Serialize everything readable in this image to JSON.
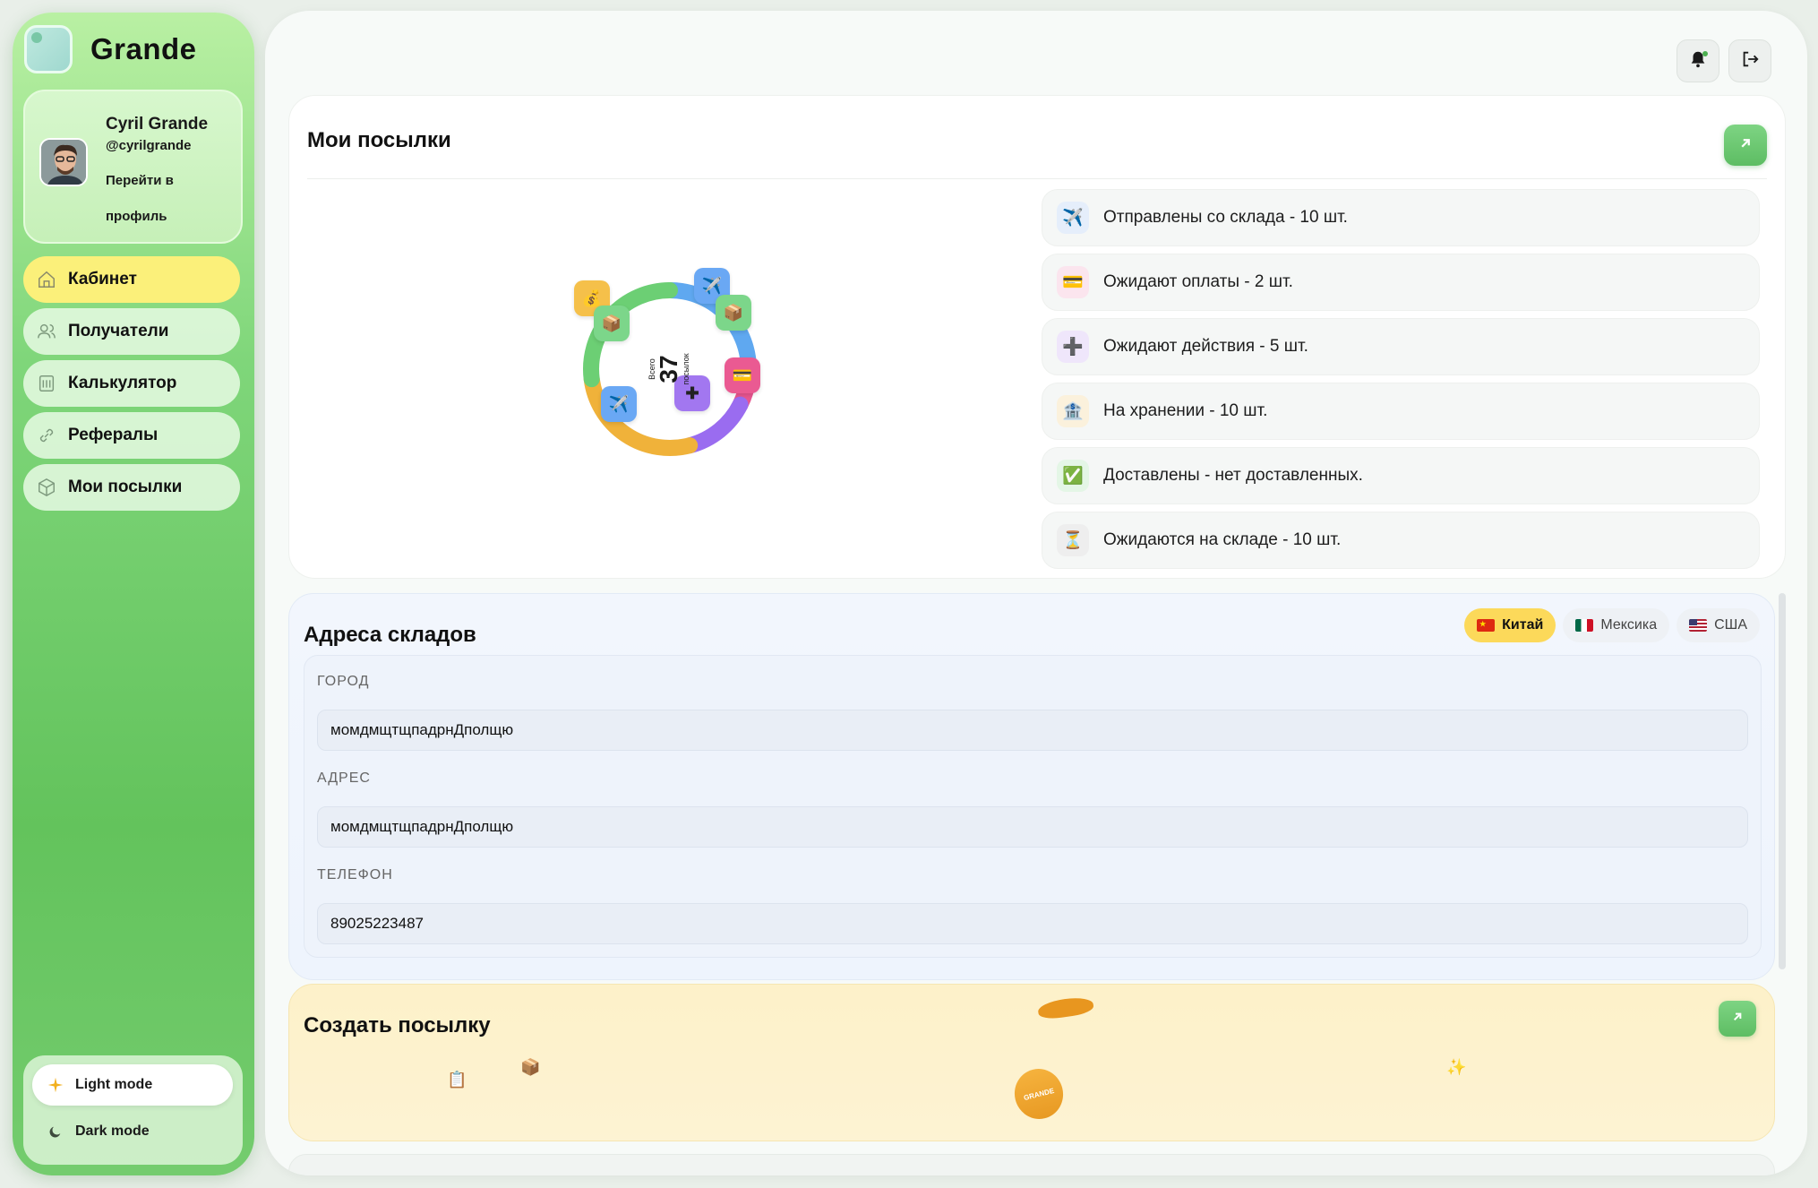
{
  "app": {
    "name": "Grande"
  },
  "profile": {
    "name": "Cyril Grande",
    "handle": "@cyrilgrande",
    "link_label": "Перейти в профиль"
  },
  "nav": {
    "items": [
      {
        "label": "Кабинет",
        "icon": "home-icon",
        "active": true
      },
      {
        "label": "Получатели",
        "icon": "users-icon",
        "active": false
      },
      {
        "label": "Калькулятор",
        "icon": "calculator-icon",
        "active": false
      },
      {
        "label": "Рефералы",
        "icon": "link-icon",
        "active": false
      },
      {
        "label": "Мои посылки",
        "icon": "box-icon",
        "active": false
      }
    ]
  },
  "theme": {
    "light_label": "Light mode",
    "dark_label": "Dark mode",
    "selected": "light"
  },
  "header": {
    "bell_icon": "bell-icon",
    "logout_icon": "logout-icon",
    "has_notification": true
  },
  "parcels": {
    "title": "Мои посылки",
    "donut": {
      "total": "37",
      "caption_top": "Всего",
      "caption_bottom": "посылок",
      "segments": [
        {
          "name": "sent",
          "value": 10,
          "color": "#5fa8f0"
        },
        {
          "name": "awaiting_payment",
          "value": 2,
          "color": "#e8558f"
        },
        {
          "name": "awaiting_action",
          "value": 5,
          "color": "#9a6cf0"
        },
        {
          "name": "storage",
          "value": 10,
          "color": "#f0b23a"
        },
        {
          "name": "awaiting_warehouse",
          "value": 10,
          "color": "#6ccf74"
        }
      ]
    },
    "statuses": [
      {
        "icon": "airplane-icon",
        "glyph": "✈️",
        "text": "Отправлены со склада - 10 шт."
      },
      {
        "icon": "card-icon",
        "glyph": "💳",
        "text": "Ожидают оплаты - 2 шт."
      },
      {
        "icon": "plus-icon",
        "glyph": "➕",
        "text": "Ожидают действия - 5 шт."
      },
      {
        "icon": "storage-icon",
        "glyph": "🏦",
        "text": "На хранении - 10 шт."
      },
      {
        "icon": "check-icon",
        "glyph": "✅",
        "text": "Доставлены - нет доставленных."
      },
      {
        "icon": "hourglass-icon",
        "glyph": "⏳",
        "text": "Ожидаются на складе - 10 шт."
      }
    ]
  },
  "warehouses": {
    "title": "Адреса складов",
    "tabs": [
      {
        "label": "Китай",
        "active": true
      },
      {
        "label": "Мексика",
        "active": false
      },
      {
        "label": "США",
        "active": false
      }
    ],
    "fields": [
      {
        "label": "ГОРОД",
        "value": "момдмщтщпадрнДполщю"
      },
      {
        "label": "АДРЕС",
        "value": "момдмщтщпадрнДполщю"
      },
      {
        "label": "ТЕЛЕФОН",
        "value": "89025223487"
      }
    ]
  },
  "create": {
    "title": "Создать посылку",
    "badge_text": "GRANDE"
  }
}
